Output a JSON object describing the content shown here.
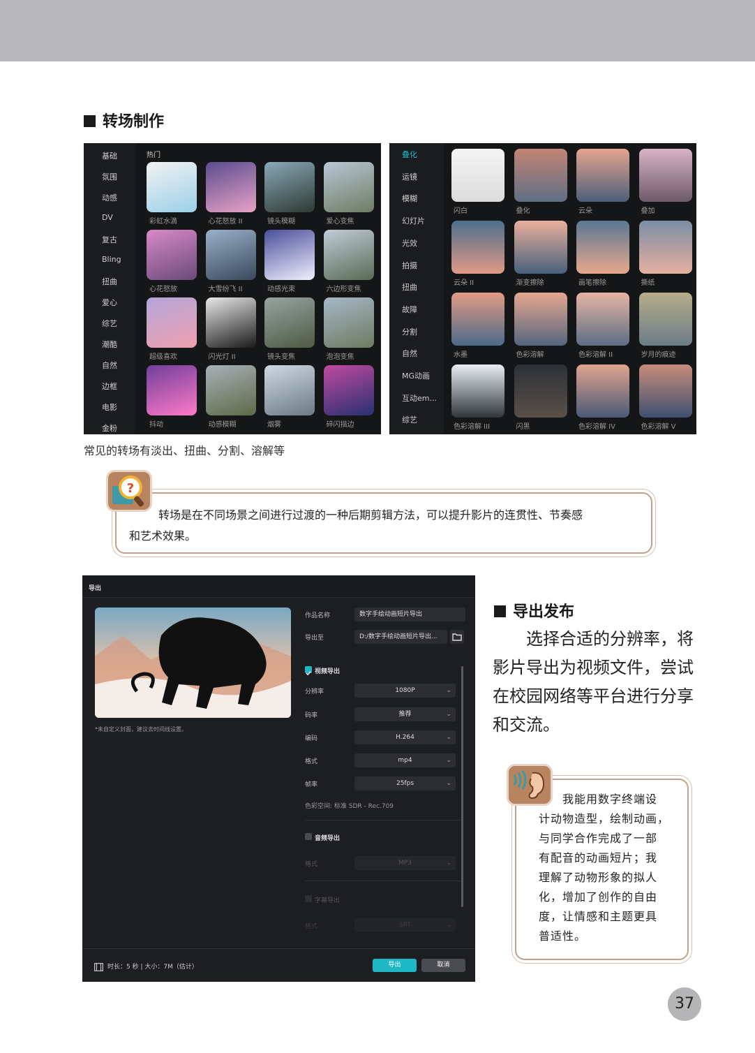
{
  "sections": {
    "transition_heading": "转场制作",
    "export_heading": "导出发布"
  },
  "left_panel": {
    "categories": [
      "基础",
      "氛围",
      "动感",
      "DV",
      "复古",
      "Bling",
      "扭曲",
      "爱心",
      "综艺",
      "潮酷",
      "自然",
      "边框",
      "电影",
      "金粉"
    ],
    "group_title": "热门",
    "tiles": [
      "彩虹水滴",
      "心花怒放 II",
      "镜头模糊",
      "爱心变焦",
      "心花怒放",
      "大雪纷飞 II",
      "动感光束",
      "六边形变焦",
      "超级喜欢",
      "闪光灯 II",
      "镜头变焦",
      "泡泡变焦",
      "抖动",
      "动感模糊",
      "烟雾",
      "碎闪描边"
    ]
  },
  "right_panel": {
    "categories": [
      "叠化",
      "运镜",
      "模糊",
      "幻灯片",
      "光效",
      "拍摄",
      "扭曲",
      "故障",
      "分割",
      "自然",
      "MG动画",
      "互动em...",
      "综艺"
    ],
    "tiles": [
      "闪白",
      "叠化",
      "云朵",
      "叠加",
      "云朵 II",
      "渐变擦除",
      "画笔擦除",
      "撕纸",
      "水墨",
      "色彩溶解",
      "色彩溶解 II",
      "岁月的痕迹",
      "色彩溶解 III",
      "闪黑",
      "色彩溶解 IV",
      "色彩溶解 V"
    ]
  },
  "caption": "常见的转场有淡出、扭曲、分割、溶解等",
  "note1": {
    "text": "转场是在不同场景之间进行过渡的一种后期剪辑方法，可以提升影片的连贯性、节奏感和艺术效果。",
    "line1": "转场是在不同场景之间进行过渡的一种后期剪辑方法，可以提升影片的连贯性、节奏感",
    "line2": "和艺术效果。"
  },
  "export_dialog": {
    "title": "导出",
    "cover_hint": "*未自定义封面，建议去时间线设置。",
    "name_label": "作品名称",
    "name_value": "数字手绘动画短片导出",
    "path_label": "导出至",
    "path_value": "D:/数字手绘动画短片导出...",
    "video_section": "视频导出",
    "resolution_label": "分辨率",
    "resolution_value": "1080P",
    "bitrate_label": "码率",
    "bitrate_value": "推荐",
    "codec_label": "编码",
    "codec_value": "H.264",
    "format_label": "格式",
    "format_value": "mp4",
    "fps_label": "帧率",
    "fps_value": "25fps",
    "colorspace": "色彩空间:  标准 SDR - Rec.709",
    "audio_section": "音频导出",
    "audio_format_label": "格式",
    "audio_format_value": "MP3",
    "subtitle_section": "字幕导出",
    "subtitle_format_label": "格式",
    "subtitle_format_value": "SRT",
    "footer_info": "时长：5 秒 | 大小：7M（估计）",
    "export_button": "导出",
    "cancel_button": "取消"
  },
  "export_paragraph": [
    "　　选择合适的分辨率，将",
    "影片导出为视频文件，尝试",
    "在校园网络等平台进行分享",
    "和交流。"
  ],
  "note2": {
    "lines": [
      "　　我能用数字终端设",
      "计动物造型，绘制动画，",
      "与同学合作完成了一部",
      "有配音的动画短片；我",
      "理解了动物形象的拟人",
      "化，增加了创作的自由",
      "度，让情感和主题更具",
      "普适性。"
    ]
  },
  "page_number": "37",
  "colors": {
    "accent": "#1fb6c6",
    "note_border": "#c4a08a",
    "badge": "#b88460"
  },
  "icons": [
    "question-magnifier-icon",
    "ear-sound-icon",
    "checkbox-icon",
    "folder-icon",
    "film-icon",
    "chevron-down-icon"
  ]
}
